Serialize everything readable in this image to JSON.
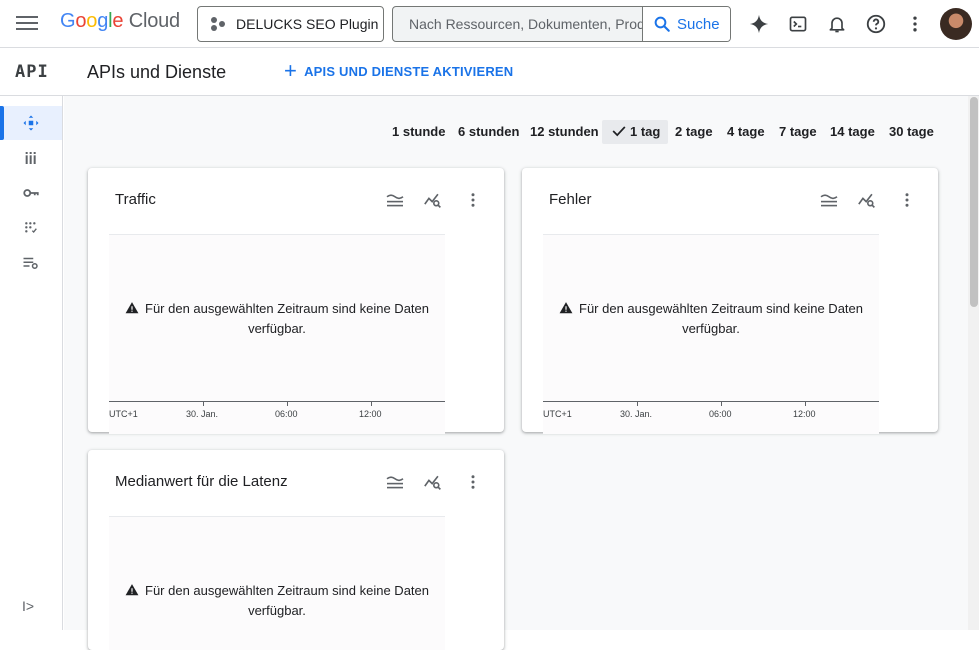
{
  "header": {
    "logo": {
      "google": "Google",
      "cloud": "Cloud"
    },
    "project_name": "DELUCKS SEO Plugin",
    "search_placeholder": "Nach Ressourcen, Dokumenten, Prod...",
    "search_button": "Suche"
  },
  "subheader": {
    "product_logo": "API",
    "page_title": "APIs und Dienste",
    "enable_button": "APIS UND DIENSTE AKTIVIEREN"
  },
  "time_ranges": {
    "items": [
      "1 stunde",
      "6 stunden",
      "12 stunden",
      "1 tag",
      "2 tage",
      "4 tage",
      "7 tage",
      "14 tage",
      "30 tage"
    ],
    "selected": "1 tag"
  },
  "cards": [
    {
      "title": "Traffic",
      "nodata_line1": "Für den ausgewählten Zeitraum sind keine Daten",
      "nodata_line2": "verfügbar.",
      "axis_labels": [
        "UTC+1",
        "30. Jan.",
        "06:00",
        "12:00"
      ]
    },
    {
      "title": "Fehler",
      "nodata_line1": "Für den ausgewählten Zeitraum sind keine Daten",
      "nodata_line2": "verfügbar.",
      "axis_labels": [
        "UTC+1",
        "30. Jan.",
        "06:00",
        "12:00"
      ]
    },
    {
      "title": "Medianwert für die Latenz",
      "nodata_line1": "Für den ausgewählten Zeitraum sind keine Daten",
      "nodata_line2": "verfügbar."
    }
  ],
  "colors": {
    "accent": "#1a73e8",
    "text": "#202124",
    "muted": "#5f6368"
  }
}
